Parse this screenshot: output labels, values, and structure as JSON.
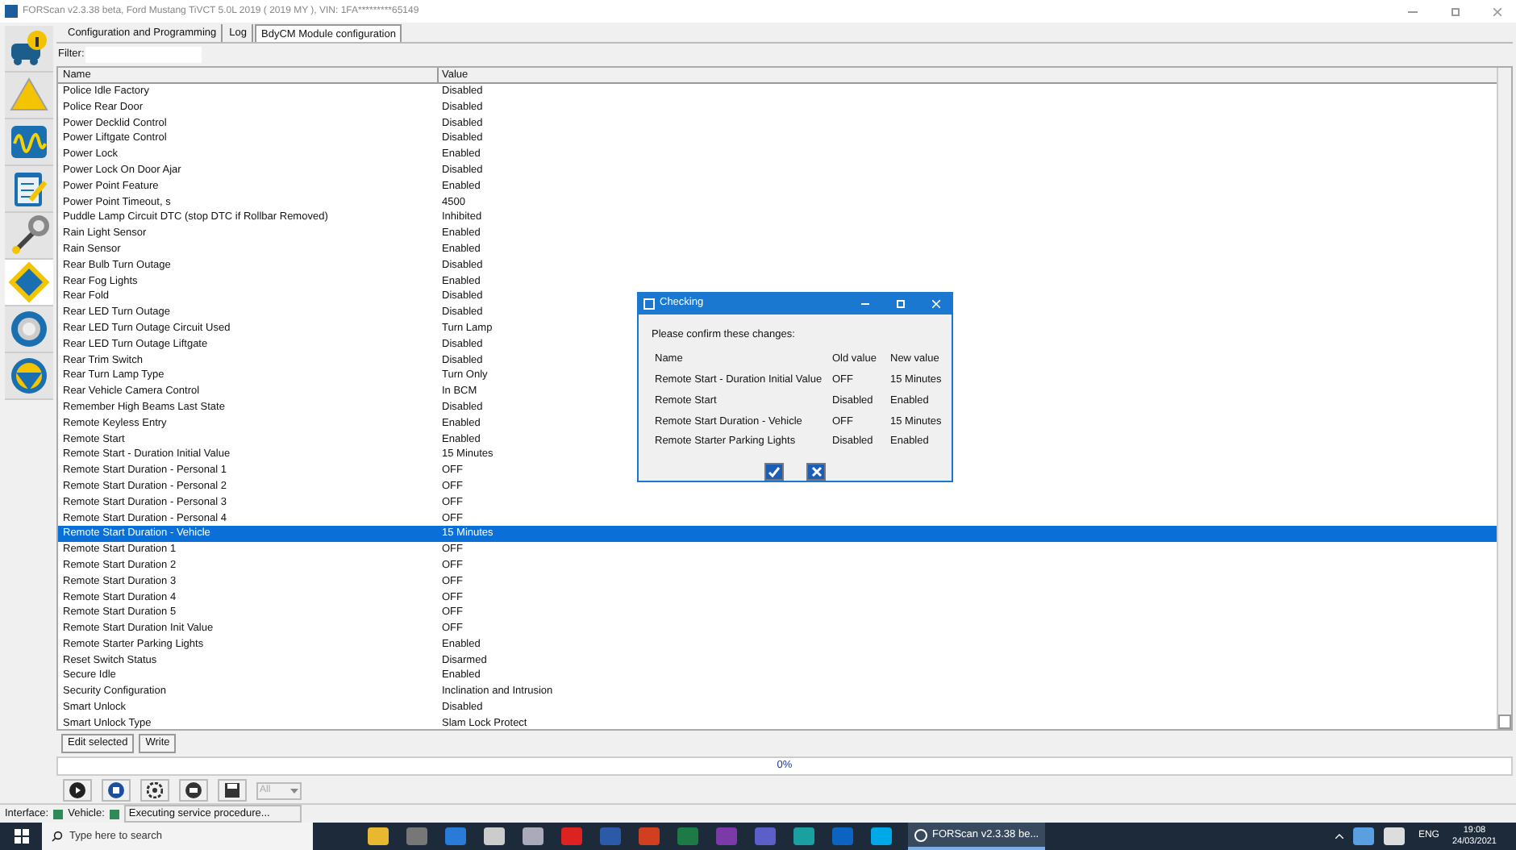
{
  "window": {
    "title": "FORScan v2.3.38 beta, Ford Mustang TiVCT 5.0L 2019 ( 2019 MY ), VIN: 1FA*********65149"
  },
  "sidebar": {
    "items": [
      {
        "kind": "info",
        "selected": false
      },
      {
        "kind": "dtc",
        "selected": false
      },
      {
        "kind": "scope",
        "selected": false
      },
      {
        "kind": "tests",
        "selected": false
      },
      {
        "kind": "service",
        "selected": false
      },
      {
        "kind": "config",
        "selected": true
      },
      {
        "kind": "settings",
        "selected": false
      },
      {
        "kind": "help",
        "selected": false
      }
    ]
  },
  "tabs": [
    {
      "label": "Configuration and Programming",
      "selected": false
    },
    {
      "label": "Log",
      "selected": false
    },
    {
      "label": "BdyCM Module configuration",
      "selected": true
    }
  ],
  "filter": {
    "label": "Filter:"
  },
  "table": {
    "columns": [
      "Name",
      "Value"
    ],
    "rows": [
      {
        "name": "Police Idle Factory",
        "value": "Disabled",
        "selected": false
      },
      {
        "name": "Police Rear Door",
        "value": "Disabled",
        "selected": false
      },
      {
        "name": "Power Decklid Control",
        "value": "Disabled",
        "selected": false
      },
      {
        "name": "Power Liftgate Control",
        "value": "Disabled",
        "selected": false
      },
      {
        "name": "Power Lock",
        "value": "Enabled",
        "selected": false
      },
      {
        "name": "Power Lock On Door Ajar",
        "value": "Disabled",
        "selected": false
      },
      {
        "name": "Power Point Feature",
        "value": "Enabled",
        "selected": false
      },
      {
        "name": "Power Point Timeout, s",
        "value": "4500",
        "selected": false
      },
      {
        "name": "Puddle Lamp Circuit DTC (stop DTC if Rollbar Removed)",
        "value": "Inhibited",
        "selected": false
      },
      {
        "name": "Rain Light Sensor",
        "value": "Enabled",
        "selected": false
      },
      {
        "name": "Rain Sensor",
        "value": "Enabled",
        "selected": false
      },
      {
        "name": "Rear Bulb Turn Outage",
        "value": "Disabled",
        "selected": false
      },
      {
        "name": "Rear Fog Lights",
        "value": "Enabled",
        "selected": false
      },
      {
        "name": "Rear Fold",
        "value": "Disabled",
        "selected": false
      },
      {
        "name": "Rear LED Turn Outage",
        "value": "Disabled",
        "selected": false
      },
      {
        "name": "Rear LED Turn Outage Circuit Used",
        "value": "Turn Lamp",
        "selected": false
      },
      {
        "name": "Rear LED Turn Outage Liftgate",
        "value": "Disabled",
        "selected": false
      },
      {
        "name": "Rear Trim Switch",
        "value": "Disabled",
        "selected": false
      },
      {
        "name": "Rear Turn Lamp Type",
        "value": "Turn Only",
        "selected": false
      },
      {
        "name": "Rear Vehicle Camera Control",
        "value": "In BCM",
        "selected": false
      },
      {
        "name": "Remember High Beams Last State",
        "value": "Disabled",
        "selected": false
      },
      {
        "name": "Remote Keyless Entry",
        "value": "Enabled",
        "selected": false
      },
      {
        "name": "Remote Start",
        "value": "Enabled",
        "selected": false
      },
      {
        "name": "Remote Start - Duration Initial Value",
        "value": "15 Minutes",
        "selected": false
      },
      {
        "name": "Remote Start Duration - Personal 1",
        "value": "OFF",
        "selected": false
      },
      {
        "name": "Remote Start Duration - Personal 2",
        "value": "OFF",
        "selected": false
      },
      {
        "name": "Remote Start Duration - Personal 3",
        "value": "OFF",
        "selected": false
      },
      {
        "name": "Remote Start Duration - Personal 4",
        "value": "OFF",
        "selected": false
      },
      {
        "name": "Remote Start Duration - Vehicle",
        "value": "15 Minutes",
        "selected": true
      },
      {
        "name": "Remote Start Duration 1",
        "value": "OFF",
        "selected": false
      },
      {
        "name": "Remote Start Duration 2",
        "value": "OFF",
        "selected": false
      },
      {
        "name": "Remote Start Duration 3",
        "value": "OFF",
        "selected": false
      },
      {
        "name": "Remote Start Duration 4",
        "value": "OFF",
        "selected": false
      },
      {
        "name": "Remote Start Duration 5",
        "value": "OFF",
        "selected": false
      },
      {
        "name": "Remote Start Duration Init Value",
        "value": "OFF",
        "selected": false
      },
      {
        "name": "Remote Starter Parking Lights",
        "value": "Enabled",
        "selected": false
      },
      {
        "name": "Reset Switch Status",
        "value": "Disarmed",
        "selected": false
      },
      {
        "name": "Secure Idle",
        "value": "Enabled",
        "selected": false
      },
      {
        "name": "Security Configuration",
        "value": "Inclination and Intrusion",
        "selected": false
      },
      {
        "name": "Smart Unlock",
        "value": "Disabled",
        "selected": false
      },
      {
        "name": "Smart Unlock Type",
        "value": "Slam Lock Protect",
        "selected": false
      }
    ]
  },
  "buttons": [
    "Edit selected",
    "Write"
  ],
  "progress": {
    "text": "0%",
    "level": 0
  },
  "toolbar": {
    "dropdown": {
      "value": "All",
      "disabled": true
    }
  },
  "status_bar": {
    "interface_label": "Interface:",
    "vehicle_label": "Vehicle:",
    "message": "Executing service procedure..."
  },
  "dialog": {
    "title": "Checking",
    "prompt": "Please confirm these changes:",
    "columns": [
      "Name",
      "Old value",
      "New value"
    ],
    "rows": [
      [
        "Remote Start - Duration Initial Value",
        "OFF",
        "15 Minutes"
      ],
      [
        "Remote Start",
        "Disabled",
        "Enabled"
      ],
      [
        "Remote Start Duration - Vehicle",
        "OFF",
        "15 Minutes"
      ],
      [
        "Remote Starter Parking Lights",
        "Disabled",
        "Enabled"
      ]
    ]
  },
  "taskbar": {
    "search_placeholder": "Type here to search",
    "task": "FORScan v2.3.38 be...",
    "language": "ENG",
    "time": "19:08",
    "date": "24/03/2021"
  }
}
